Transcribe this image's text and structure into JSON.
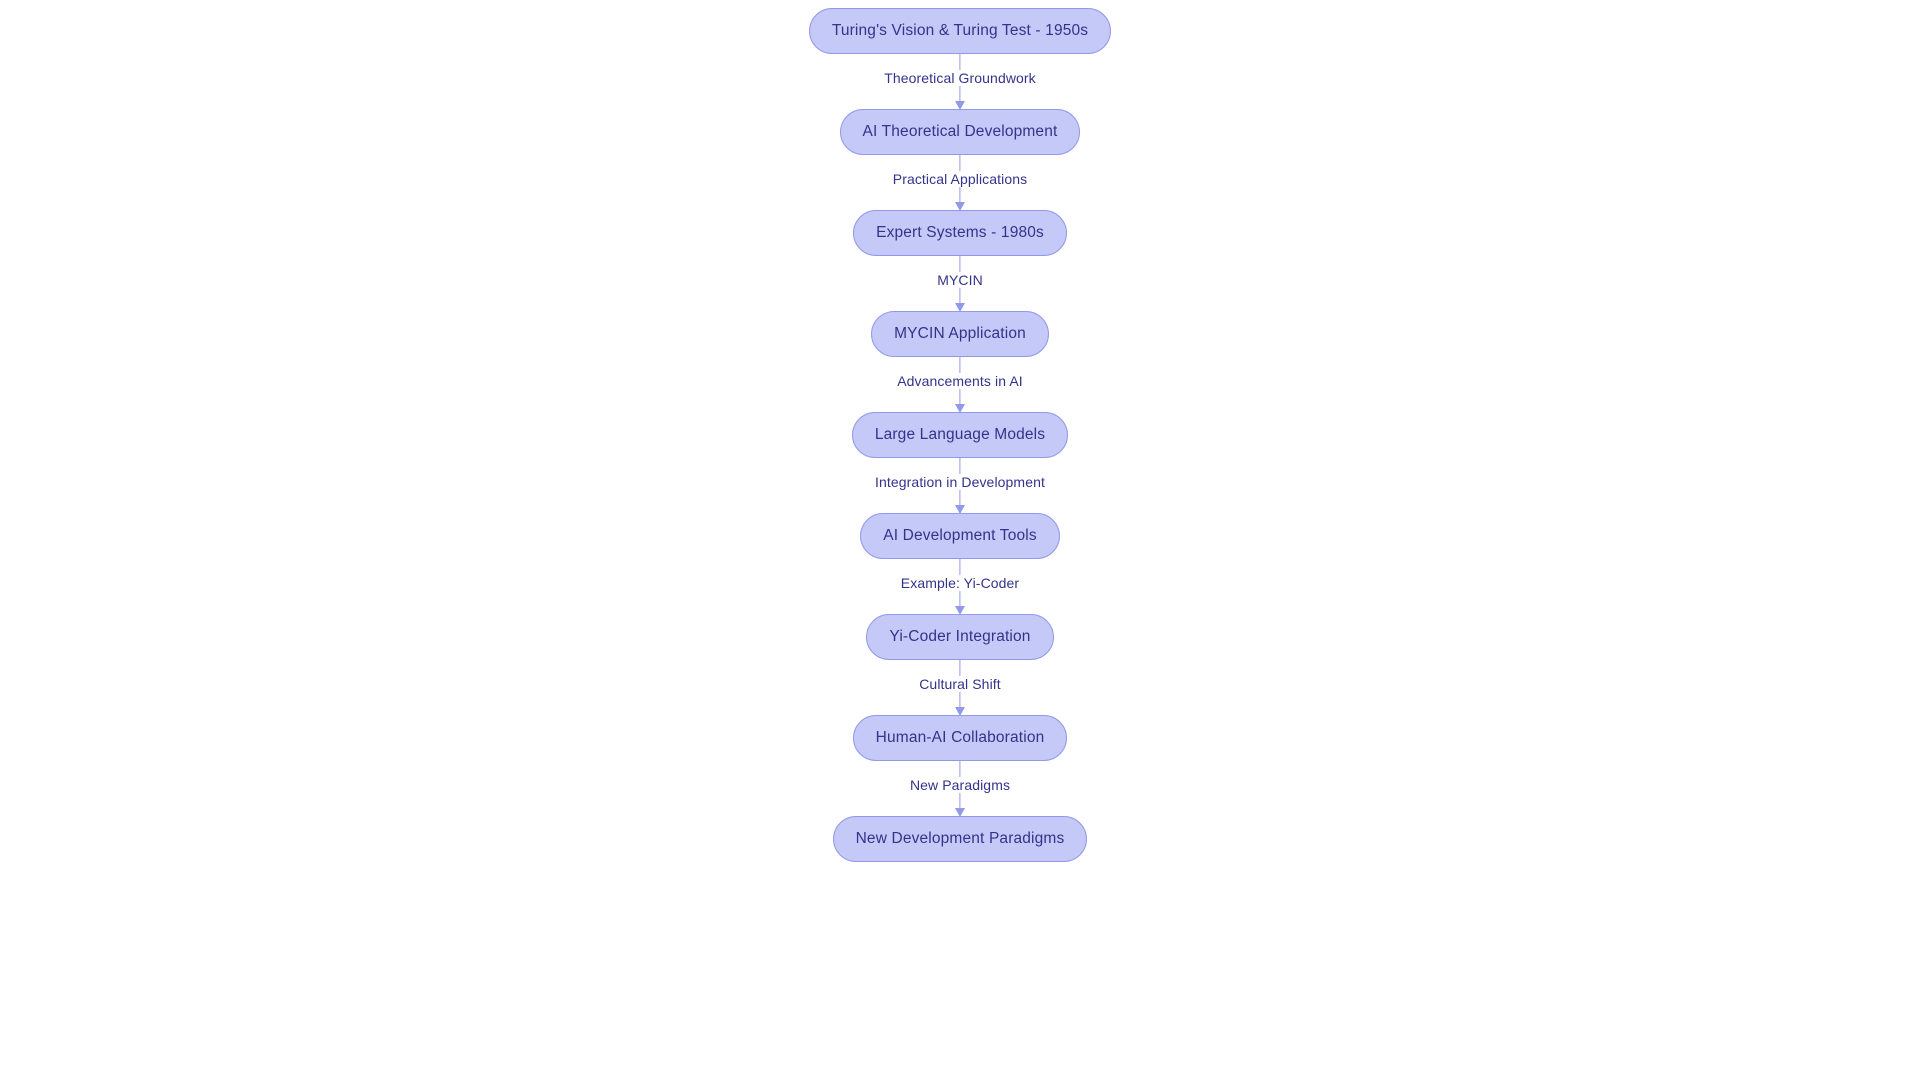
{
  "diagram": {
    "type": "flowchart",
    "direction": "top-to-bottom",
    "colors": {
      "node_fill": "#c5c9f7",
      "node_border": "#9299e8",
      "node_text": "#33338c",
      "edge_line": "#9299e8",
      "edge_label_text": "#33338c",
      "background": "#ffffff"
    },
    "nodes": [
      {
        "id": "turing",
        "label": "Turing's Vision & Turing Test - 1950s"
      },
      {
        "id": "ai_theory",
        "label": "AI Theoretical Development"
      },
      {
        "id": "expert_sys",
        "label": "Expert Systems - 1980s"
      },
      {
        "id": "mycin_app",
        "label": "MYCIN Application"
      },
      {
        "id": "llm",
        "label": "Large Language Models"
      },
      {
        "id": "ai_tools",
        "label": "AI Development Tools"
      },
      {
        "id": "yi_coder",
        "label": "Yi-Coder Integration"
      },
      {
        "id": "human_ai",
        "label": "Human-AI Collaboration"
      },
      {
        "id": "new_paradig",
        "label": "New Development Paradigms"
      }
    ],
    "edges": [
      {
        "from": "turing",
        "to": "ai_theory",
        "label": "Theoretical Groundwork"
      },
      {
        "from": "ai_theory",
        "to": "expert_sys",
        "label": "Practical Applications"
      },
      {
        "from": "expert_sys",
        "to": "mycin_app",
        "label": "MYCIN"
      },
      {
        "from": "mycin_app",
        "to": "llm",
        "label": "Advancements in AI"
      },
      {
        "from": "llm",
        "to": "ai_tools",
        "label": "Integration in Development"
      },
      {
        "from": "ai_tools",
        "to": "yi_coder",
        "label": "Example: Yi-Coder"
      },
      {
        "from": "yi_coder",
        "to": "human_ai",
        "label": "Cultural Shift"
      },
      {
        "from": "human_ai",
        "to": "new_paradig",
        "label": "New Paradigms"
      }
    ]
  }
}
